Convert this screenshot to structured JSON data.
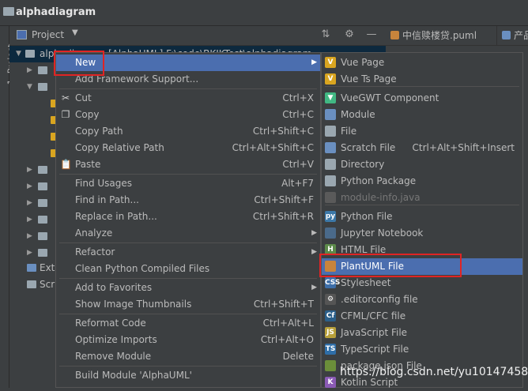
{
  "window": {
    "title": "alphadiagram"
  },
  "left_strip": {
    "tab_label": "1: Project"
  },
  "project_panel": {
    "label": "Project",
    "dropdown_glyph": "▼"
  },
  "toolbar_icons": [
    "collapse-icon",
    "gear-icon",
    "minimize-icon"
  ],
  "editor_tabs": [
    {
      "label": "中信赎楼贷.puml",
      "icon": "plantuml-file-icon"
    },
    {
      "label": "产品",
      "icon": "plantuml-file-icon"
    }
  ],
  "tree": {
    "root_label": "alphadiagram [AlphaUML]  F:\\code\\BKJKTest\\alphadiagram",
    "rows": [
      {
        "label": "Exte",
        "icon": "external-libraries-icon"
      },
      {
        "label": "Scr",
        "icon": "scratches-icon"
      }
    ]
  },
  "context_menu": {
    "items": [
      {
        "label": "New",
        "shortcut": "",
        "submenu": true,
        "highlighted": true,
        "icon": ""
      },
      {
        "label": "Add Framework Support...",
        "shortcut": "",
        "submenu": false,
        "icon": ""
      },
      {
        "label": "Cut",
        "shortcut": "Ctrl+X",
        "submenu": false,
        "icon": "scissors-icon"
      },
      {
        "label": "Copy",
        "shortcut": "Ctrl+C",
        "submenu": false,
        "icon": "copy-icon"
      },
      {
        "label": "Copy Path",
        "shortcut": "Ctrl+Shift+C",
        "submenu": false,
        "icon": ""
      },
      {
        "label": "Copy Relative Path",
        "shortcut": "Ctrl+Alt+Shift+C",
        "submenu": false,
        "icon": ""
      },
      {
        "label": "Paste",
        "shortcut": "Ctrl+V",
        "submenu": false,
        "icon": "paste-icon"
      },
      {
        "label": "Find Usages",
        "shortcut": "Alt+F7",
        "submenu": false,
        "icon": ""
      },
      {
        "label": "Find in Path...",
        "shortcut": "Ctrl+Shift+F",
        "submenu": false,
        "icon": ""
      },
      {
        "label": "Replace in Path...",
        "shortcut": "Ctrl+Shift+R",
        "submenu": false,
        "icon": ""
      },
      {
        "label": "Analyze",
        "shortcut": "",
        "submenu": true,
        "icon": ""
      },
      {
        "label": "Refactor",
        "shortcut": "",
        "submenu": true,
        "icon": ""
      },
      {
        "label": "Clean Python Compiled Files",
        "shortcut": "",
        "submenu": false,
        "icon": ""
      },
      {
        "label": "Add to Favorites",
        "shortcut": "",
        "submenu": true,
        "icon": ""
      },
      {
        "label": "Show Image Thumbnails",
        "shortcut": "Ctrl+Shift+T",
        "submenu": false,
        "icon": ""
      },
      {
        "label": "Reformat Code",
        "shortcut": "Ctrl+Alt+L",
        "submenu": false,
        "icon": ""
      },
      {
        "label": "Optimize Imports",
        "shortcut": "Ctrl+Alt+O",
        "submenu": false,
        "icon": ""
      },
      {
        "label": "Remove Module",
        "shortcut": "Delete",
        "submenu": false,
        "icon": ""
      },
      {
        "label": "Build Module 'AlphaUML'",
        "shortcut": "",
        "submenu": false,
        "icon": ""
      }
    ]
  },
  "new_submenu": {
    "items": [
      {
        "label": "Vue Page",
        "shortcut": "",
        "icon": "vue-icon",
        "color": "#d9a520",
        "glyph": "V"
      },
      {
        "label": "Vue Ts Page",
        "shortcut": "",
        "icon": "vue-icon",
        "color": "#d9a520",
        "glyph": "V"
      },
      {
        "label": "VueGWT Component",
        "shortcut": "",
        "icon": "vuegwt-icon",
        "color": "#41b883",
        "glyph": "▼"
      },
      {
        "label": "Module",
        "shortcut": "",
        "icon": "module-icon",
        "color": "#6a8fc0",
        "glyph": ""
      },
      {
        "label": "File",
        "shortcut": "",
        "icon": "file-icon",
        "color": "#9aa7b0",
        "glyph": ""
      },
      {
        "label": "Scratch File",
        "shortcut": "Ctrl+Alt+Shift+Insert",
        "icon": "scratch-file-icon",
        "color": "#6a8fc0",
        "glyph": ""
      },
      {
        "label": "Directory",
        "shortcut": "",
        "icon": "folder-icon",
        "color": "#9aa7b0",
        "glyph": ""
      },
      {
        "label": "Python Package",
        "shortcut": "",
        "icon": "python-package-icon",
        "color": "#9aa7b0",
        "glyph": ""
      },
      {
        "label": "module-info.java",
        "shortcut": "",
        "icon": "java-icon",
        "color": "#5a5a5a",
        "glyph": "",
        "disabled": true
      },
      {
        "label": "Python File",
        "shortcut": "",
        "icon": "python-file-icon",
        "color": "#3c78a8",
        "glyph": "py"
      },
      {
        "label": "Jupyter Notebook",
        "shortcut": "",
        "icon": "jupyter-icon",
        "color": "#4a6a8a",
        "glyph": ""
      },
      {
        "label": "HTML File",
        "shortcut": "",
        "icon": "html-file-icon",
        "color": "#5c8a4a",
        "glyph": "H"
      },
      {
        "label": "PlantUML File",
        "shortcut": "",
        "icon": "plantuml-file-icon",
        "color": "#c8843c",
        "glyph": "",
        "highlighted": true
      },
      {
        "label": "Stylesheet",
        "shortcut": "",
        "icon": "css-file-icon",
        "color": "#3d6ea8",
        "glyph": "CSS"
      },
      {
        "label": ".editorconfig file",
        "shortcut": "",
        "icon": "editorconfig-icon",
        "color": "#555555",
        "glyph": "⚙"
      },
      {
        "label": "CFML/CFC file",
        "shortcut": "",
        "icon": "cfml-icon",
        "color": "#2b5f8a",
        "glyph": "Cf"
      },
      {
        "label": "JavaScript File",
        "shortcut": "",
        "icon": "javascript-file-icon",
        "color": "#b8a03a",
        "glyph": "JS"
      },
      {
        "label": "TypeScript File",
        "shortcut": "",
        "icon": "typescript-file-icon",
        "color": "#2f6ea8",
        "glyph": "TS"
      },
      {
        "label": "package.json File",
        "shortcut": "",
        "icon": "package-json-icon",
        "color": "#6b8e3a",
        "glyph": ""
      },
      {
        "label": "Kotlin Script",
        "shortcut": "",
        "icon": "kotlin-icon",
        "color": "#8a5ab5",
        "glyph": "K"
      }
    ]
  },
  "watermark": "https://blog.csdn.net/yu1014745867",
  "colors": {
    "highlight": "#4b6eaf",
    "annotation_box": "#e02424"
  }
}
